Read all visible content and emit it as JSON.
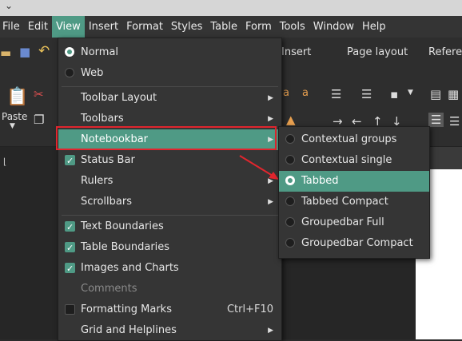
{
  "menubar": {
    "items": [
      "File",
      "Edit",
      "View",
      "Insert",
      "Format",
      "Styles",
      "Table",
      "Form",
      "Tools",
      "Window",
      "Help"
    ],
    "active": "View"
  },
  "notebookbar_tabs": [
    "Insert",
    "Page layout",
    "Referen"
  ],
  "ribbon": {
    "paste_label": "Paste"
  },
  "view_menu": {
    "normal": "Normal",
    "web": "Web",
    "toolbar_layout": "Toolbar Layout",
    "toolbars": "Toolbars",
    "notebookbar": "Notebookbar",
    "status_bar": "Status Bar",
    "rulers": "Rulers",
    "scrollbars": "Scrollbars",
    "text_boundaries": "Text Boundaries",
    "table_boundaries": "Table Boundaries",
    "images_and_charts": "Images and Charts",
    "comments": "Comments",
    "formatting_marks": "Formatting Marks",
    "formatting_marks_shortcut": "Ctrl+F10",
    "grid_and_helplines": "Grid and Helplines"
  },
  "notebookbar_submenu": {
    "items": [
      "Contextual groups",
      "Contextual single",
      "Tabbed",
      "Tabbed Compact",
      "Groupedbar Full",
      "Groupedbar Compact"
    ],
    "selected": "Tabbed"
  },
  "colors": {
    "accent": "#4f9a85",
    "annotation_red": "#e0262e"
  }
}
